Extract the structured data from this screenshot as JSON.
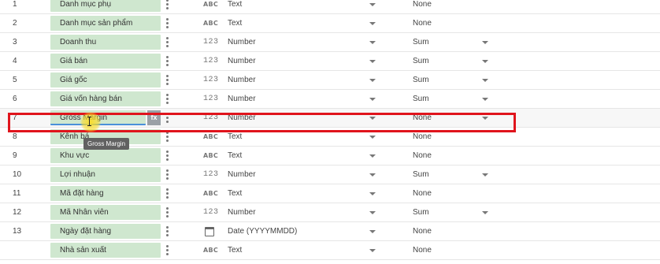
{
  "rows": [
    {
      "num": "1",
      "field": "Danh mục phụ",
      "type_icon": "ABC",
      "type": "Text",
      "aggregation": "None",
      "agg_caret": false,
      "icon": "text-type-icon"
    },
    {
      "num": "2",
      "field": "Danh mục sản phẩm",
      "type_icon": "ABC",
      "type": "Text",
      "aggregation": "None",
      "agg_caret": false,
      "icon": "text-type-icon"
    },
    {
      "num": "3",
      "field": "Doanh thu",
      "type_icon": "123",
      "type": "Number",
      "aggregation": "Sum",
      "agg_caret": true,
      "icon": "number-type-icon"
    },
    {
      "num": "4",
      "field": "Giá bán",
      "type_icon": "123",
      "type": "Number",
      "aggregation": "Sum",
      "agg_caret": true,
      "icon": "number-type-icon"
    },
    {
      "num": "5",
      "field": "Giá gốc",
      "type_icon": "123",
      "type": "Number",
      "aggregation": "Sum",
      "agg_caret": true,
      "icon": "number-type-icon"
    },
    {
      "num": "6",
      "field": "Giá vốn hàng bán",
      "type_icon": "123",
      "type": "Number",
      "aggregation": "Sum",
      "agg_caret": true,
      "icon": "number-type-icon"
    },
    {
      "num": "7",
      "field": "Gross Margin",
      "type_icon": "123",
      "type": "Number",
      "aggregation": "None",
      "agg_caret": true,
      "icon": "number-type-icon",
      "editing": true
    },
    {
      "num": "8",
      "field": "Kênh bá",
      "type_icon": "ABC",
      "type": "Text",
      "aggregation": "None",
      "agg_caret": false,
      "icon": "text-type-icon"
    },
    {
      "num": "9",
      "field": "Khu vực",
      "type_icon": "ABC",
      "type": "Text",
      "aggregation": "None",
      "agg_caret": false,
      "icon": "text-type-icon"
    },
    {
      "num": "10",
      "field": "Lợi nhuận",
      "type_icon": "123",
      "type": "Number",
      "aggregation": "Sum",
      "agg_caret": true,
      "icon": "number-type-icon"
    },
    {
      "num": "11",
      "field": "Mã đặt hàng",
      "type_icon": "ABC",
      "type": "Text",
      "aggregation": "None",
      "agg_caret": false,
      "icon": "text-type-icon"
    },
    {
      "num": "12",
      "field": "Mã Nhân viên",
      "type_icon": "123",
      "type": "Number",
      "aggregation": "Sum",
      "agg_caret": true,
      "icon": "number-type-icon"
    },
    {
      "num": "13",
      "field": "Ngày đặt hàng",
      "type_icon": "",
      "type": "Date (YYYYMMDD)",
      "aggregation": "None",
      "agg_caret": false,
      "icon": "calendar-icon"
    },
    {
      "num": "",
      "field": "Nhà sản xuất",
      "type_icon": "ABC",
      "type": "Text",
      "aggregation": "None",
      "agg_caret": false,
      "icon": "text-type-icon"
    }
  ],
  "fx_label": "fx",
  "tooltip": "Gross Margin",
  "colors": {
    "field_bg": "#cfe7cf",
    "highlight": "#e0141c",
    "cursor": "#fadc28"
  }
}
